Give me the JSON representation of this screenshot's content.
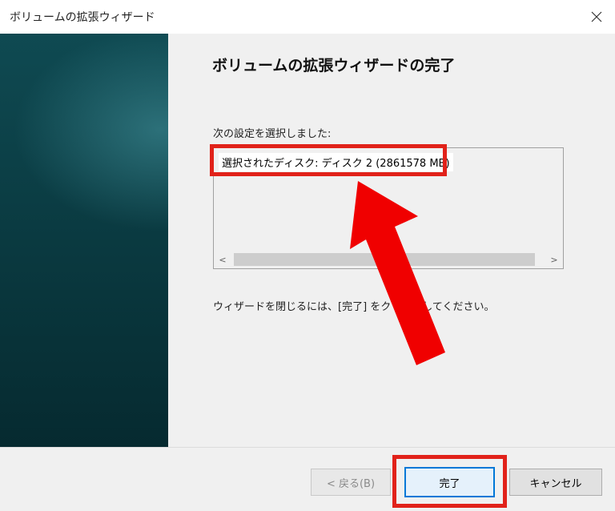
{
  "window": {
    "title": "ボリュームの拡張ウィザード",
    "close_glyph": "✕"
  },
  "page": {
    "heading": "ボリュームの拡張ウィザードの完了",
    "settings_label": "次の設定を選択しました:",
    "selected_settings": [
      "選択されたディスク: ディスク 2 (2861578 MB)"
    ],
    "instruction": "ウィザードを閉じるには、[完了] をクリックしてください。"
  },
  "scrollbar": {
    "left_arrow": "<",
    "right_arrow": ">"
  },
  "buttons": {
    "back": "< 戻る(B)",
    "finish": "完了",
    "cancel": "キャンセル"
  },
  "annotations": {
    "highlight_color": "#e1221a",
    "arrow_color": "#f00000"
  }
}
